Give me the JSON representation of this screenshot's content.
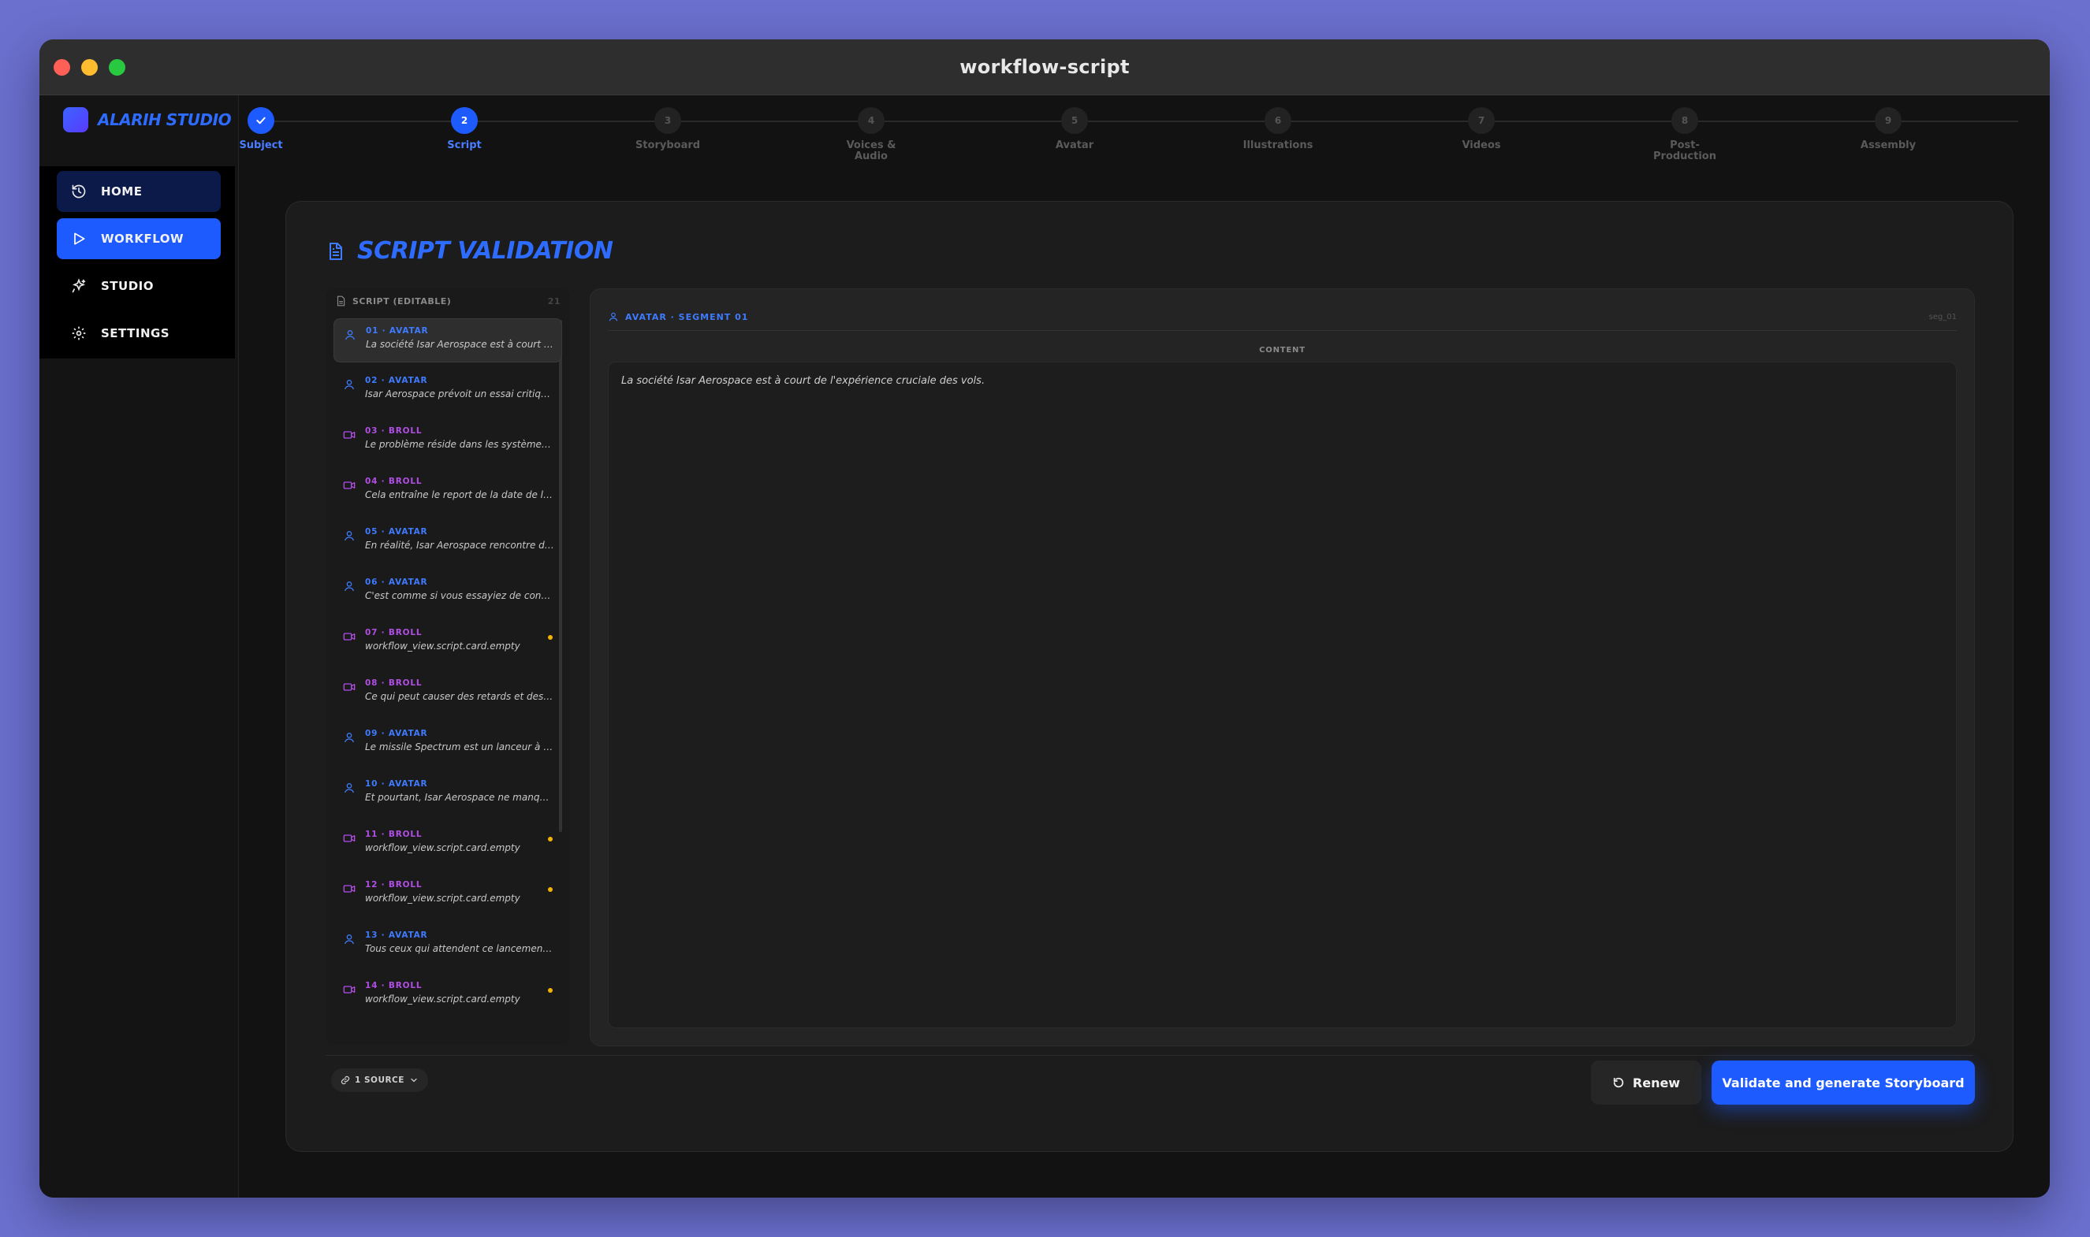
{
  "window": {
    "title": "workflow-script"
  },
  "brand": {
    "name": "ALARIH STUDIO"
  },
  "nav": {
    "items": [
      {
        "label": "HOME",
        "icon": "history-icon"
      },
      {
        "label": "WORKFLOW",
        "icon": "play-icon",
        "active": true
      },
      {
        "label": "STUDIO",
        "icon": "sparkles-icon"
      },
      {
        "label": "SETTINGS",
        "icon": "gear-icon"
      }
    ]
  },
  "stepper": {
    "steps": [
      {
        "num": "",
        "label": "Subject",
        "state": "done"
      },
      {
        "num": "2",
        "label": "Script",
        "state": "active"
      },
      {
        "num": "3",
        "label": "Storyboard",
        "state": "pending"
      },
      {
        "num": "4",
        "label": "Voices & Audio",
        "label1": "Voices &",
        "label2": "Audio",
        "state": "pending"
      },
      {
        "num": "5",
        "label": "Avatar",
        "state": "pending"
      },
      {
        "num": "6",
        "label": "Illustrations",
        "state": "pending"
      },
      {
        "num": "7",
        "label": "Videos",
        "state": "pending"
      },
      {
        "num": "8",
        "label": "Post-Production",
        "label1": "Post-",
        "label2": "Production",
        "state": "pending"
      },
      {
        "num": "9",
        "label": "Assembly",
        "state": "pending"
      }
    ]
  },
  "main": {
    "title": "SCRIPT VALIDATION",
    "script_panel": {
      "header": "SCRIPT (EDITABLE)",
      "count": "21",
      "segments": [
        {
          "tag": "01 · AVATAR",
          "type": "avatar",
          "text": "La société Isar Aerospace est à court de l'expérience cruciale des vols.",
          "selected": true,
          "warning": false
        },
        {
          "tag": "02 · AVATAR",
          "type": "avatar",
          "text": "Isar Aerospace prévoit un essai critique de son lanceur.",
          "warning": false
        },
        {
          "tag": "03 · BROLL",
          "type": "broll",
          "text": "Le problème réside dans les systèmes de flux.",
          "warning": false
        },
        {
          "tag": "04 · BROLL",
          "type": "broll",
          "text": "Cela entraîne le report de la date de lancement.",
          "warning": false
        },
        {
          "tag": "05 · AVATAR",
          "type": "avatar",
          "text": "En réalité, Isar Aerospace rencontre des problèmes.",
          "warning": false
        },
        {
          "tag": "06 · AVATAR",
          "type": "avatar",
          "text": "C'est comme si vous essayiez de conduire une voiture.",
          "warning": false
        },
        {
          "tag": "07 · BROLL",
          "type": "broll",
          "text": "workflow_view.script.card.empty",
          "warning": true
        },
        {
          "tag": "08 · BROLL",
          "type": "broll",
          "text": "Ce qui peut causer des retards et des problèmes.",
          "warning": false
        },
        {
          "tag": "09 · AVATAR",
          "type": "avatar",
          "text": "Le missile Spectrum est un lanceur à deux étages.",
          "warning": false
        },
        {
          "tag": "10 · AVATAR",
          "type": "avatar",
          "text": "Et pourtant, Isar Aerospace ne manque pas d'ambition.",
          "warning": false
        },
        {
          "tag": "11 · BROLL",
          "type": "broll",
          "text": "workflow_view.script.card.empty",
          "warning": true
        },
        {
          "tag": "12 · BROLL",
          "type": "broll",
          "text": "workflow_view.script.card.empty",
          "warning": true
        },
        {
          "tag": "13 · AVATAR",
          "type": "avatar",
          "text": "Tous ceux qui attendent ce lancement pour voir.",
          "warning": false
        },
        {
          "tag": "14 · BROLL",
          "type": "broll",
          "text": "workflow_view.script.card.empty",
          "warning": true
        }
      ]
    },
    "detail": {
      "title": "AVATAR · SEGMENT 01",
      "id": "seg_01",
      "content_label": "CONTENT",
      "content": "La société Isar Aerospace est à court de l'expérience cruciale des vols."
    },
    "footer": {
      "source_label": "1 SOURCE",
      "renew_label": "Renew",
      "validate_label": "Validate and generate Storyboard"
    }
  },
  "colors": {
    "accent": "#1e5bff",
    "avatar": "#3e7bff",
    "broll": "#b14ee6",
    "warning": "#f5b301"
  }
}
